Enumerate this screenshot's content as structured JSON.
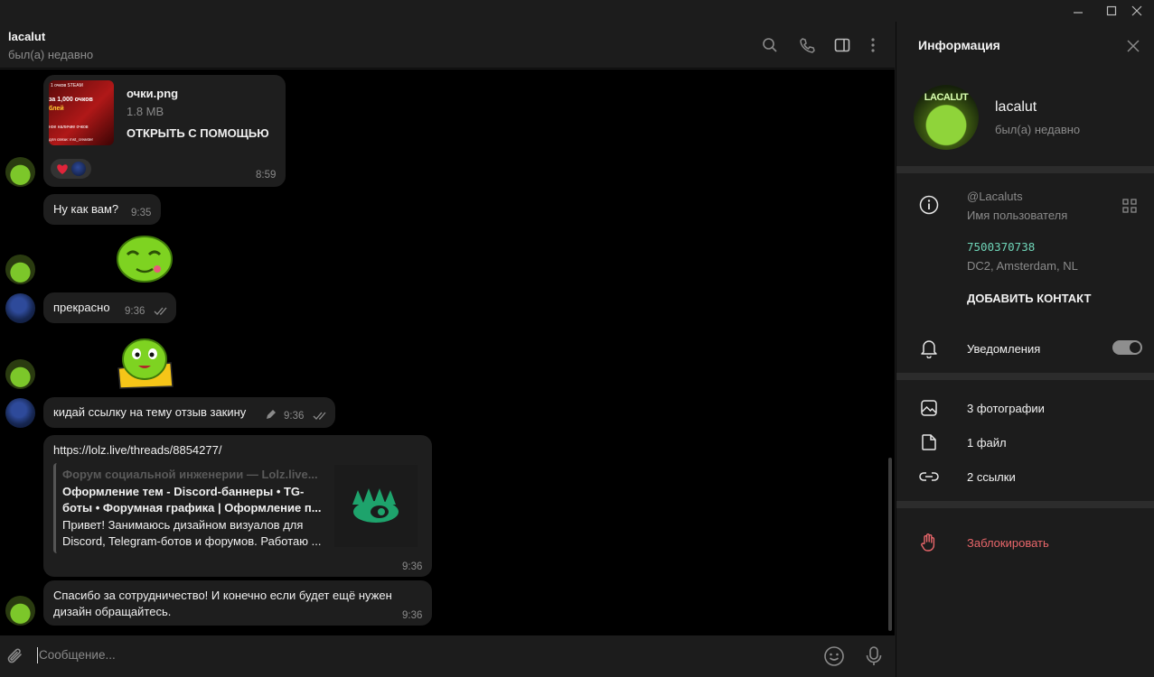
{
  "window": {
    "minimize": "—",
    "maximize": "▢",
    "close": "✕"
  },
  "header": {
    "name": "lacalut",
    "status": "был(а) недавно"
  },
  "messages": {
    "file": {
      "name": "очки.png",
      "size": "1.8 MB",
      "action": "ОТКРЫТЬ С ПОМОЩЬЮ",
      "time": "8:59",
      "thumb_lines": [
        "за 1,000 очков",
        "блей",
        "ное наличие очков",
        "для связи: mst_creaster"
      ],
      "thumb_top": "1 очков STEAM"
    },
    "m1": {
      "text": "Ну как вам?",
      "time": "9:35"
    },
    "m2": {
      "text": "прекрасно",
      "time": "9:36"
    },
    "m3": {
      "text": "кидай ссылку на тему отзыв закину",
      "time": "9:36"
    },
    "link": {
      "url": "https://lolz.live/threads/8854277/",
      "site": "Форум социальной инженерии — Lolz.live...",
      "title_1": "Оформление тем - Discord-баннеры • TG-",
      "title_2": "боты • Форумная графика | Оформление п...",
      "desc_1": "Привет! Занимаюсь дизайном визуалов для",
      "desc_2": "Discord, Telegram-ботов и форумов. Работаю ...",
      "time": "9:36"
    },
    "m4": {
      "line_1": "Спасибо за сотрудничество!  И конечно если будет ещё нужен",
      "line_2": "дизайн обращайтесь.",
      "time": "9:36"
    }
  },
  "composer": {
    "placeholder": "Сообщение..."
  },
  "info": {
    "title": "Информация",
    "name": "lacalut",
    "status": "был(а) недавно",
    "avatar_text": "LACALUT",
    "username": "@Lacaluts",
    "username_label": "Имя пользователя",
    "phone": "7500370738",
    "dc": "DC2, Amsterdam, NL",
    "add_contact": "ДОБАВИТЬ КОНТАКТ",
    "notifications": "Уведомления",
    "notifications_on": true,
    "photos": "3 фотографии",
    "files": "1 файл",
    "links": "2 ссылки",
    "block": "Заблокировать"
  },
  "colors": {
    "accent": "#6fd5b8",
    "danger": "#e8666a",
    "bubble": "#1e1e1e",
    "heart": "#e0243a"
  }
}
